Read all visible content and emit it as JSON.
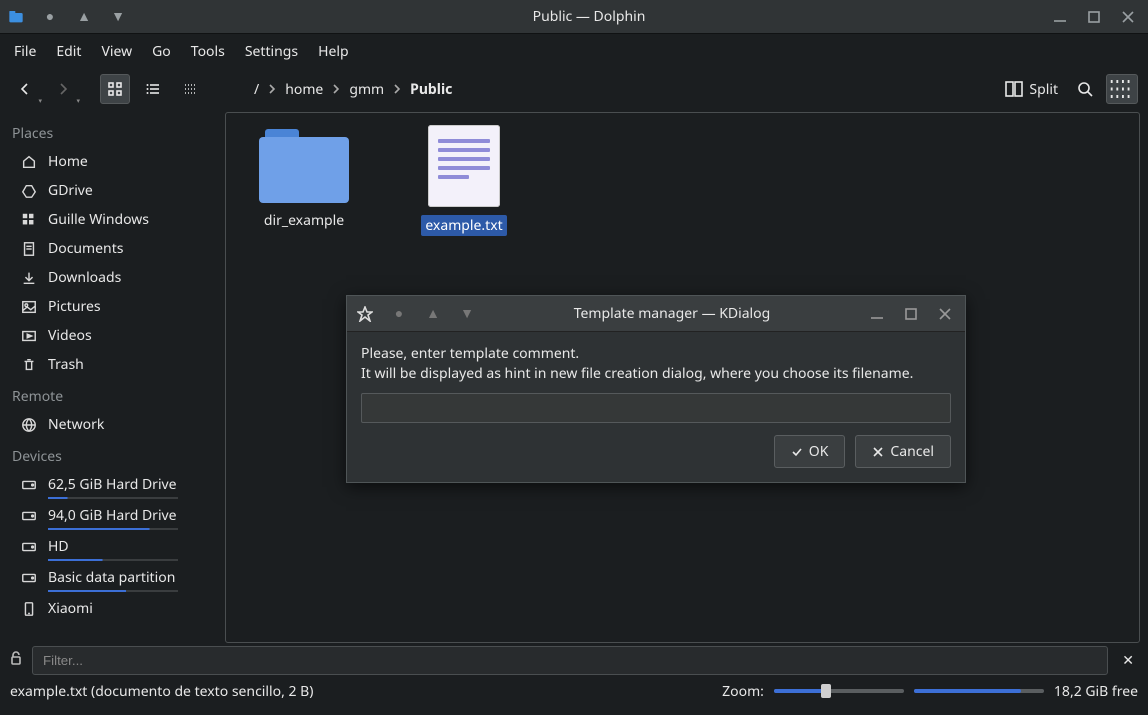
{
  "window": {
    "title": "Public — Dolphin"
  },
  "menu": [
    "File",
    "Edit",
    "View",
    "Go",
    "Tools",
    "Settings",
    "Help"
  ],
  "breadcrumb": {
    "root": "/",
    "parts": [
      "home",
      "gmm"
    ],
    "current": "Public"
  },
  "toolbar": {
    "split": "Split"
  },
  "sidebar": {
    "places_header": "Places",
    "places": [
      {
        "icon": "home",
        "label": "Home"
      },
      {
        "icon": "gdrive",
        "label": "GDrive"
      },
      {
        "icon": "windows",
        "label": "Guille Windows"
      },
      {
        "icon": "doc",
        "label": "Documents"
      },
      {
        "icon": "download",
        "label": "Downloads"
      },
      {
        "icon": "picture",
        "label": "Pictures"
      },
      {
        "icon": "video",
        "label": "Videos"
      },
      {
        "icon": "trash",
        "label": "Trash"
      }
    ],
    "remote_header": "Remote",
    "remote": [
      {
        "icon": "globe",
        "label": "Network"
      }
    ],
    "devices_header": "Devices",
    "devices": [
      {
        "icon": "drive",
        "label": "62,5 GiB Hard Drive",
        "bar": 15
      },
      {
        "icon": "drive",
        "label": "94,0 GiB Hard Drive",
        "bar": 78
      },
      {
        "icon": "drive",
        "label": "HD",
        "bar": 42
      },
      {
        "icon": "drive",
        "label": "Basic data partition",
        "bar": 60
      },
      {
        "icon": "phone",
        "label": "Xiaomi",
        "bar": null
      }
    ]
  },
  "files": {
    "folder_name": "dir_example",
    "text_name": "example.txt"
  },
  "filter": {
    "placeholder": "Filter..."
  },
  "status": {
    "left": "example.txt (documento de texto sencillo, 2 B)",
    "zoom_label": "Zoom:",
    "zoom_percent": 40,
    "disk_percent": 82,
    "free": "18,2 GiB free"
  },
  "dialog": {
    "title": "Template manager — KDialog",
    "line1": "Please, enter template comment.",
    "line2": "It will be displayed as hint in new file creation dialog, where you choose its filename.",
    "ok": "OK",
    "cancel": "Cancel"
  }
}
